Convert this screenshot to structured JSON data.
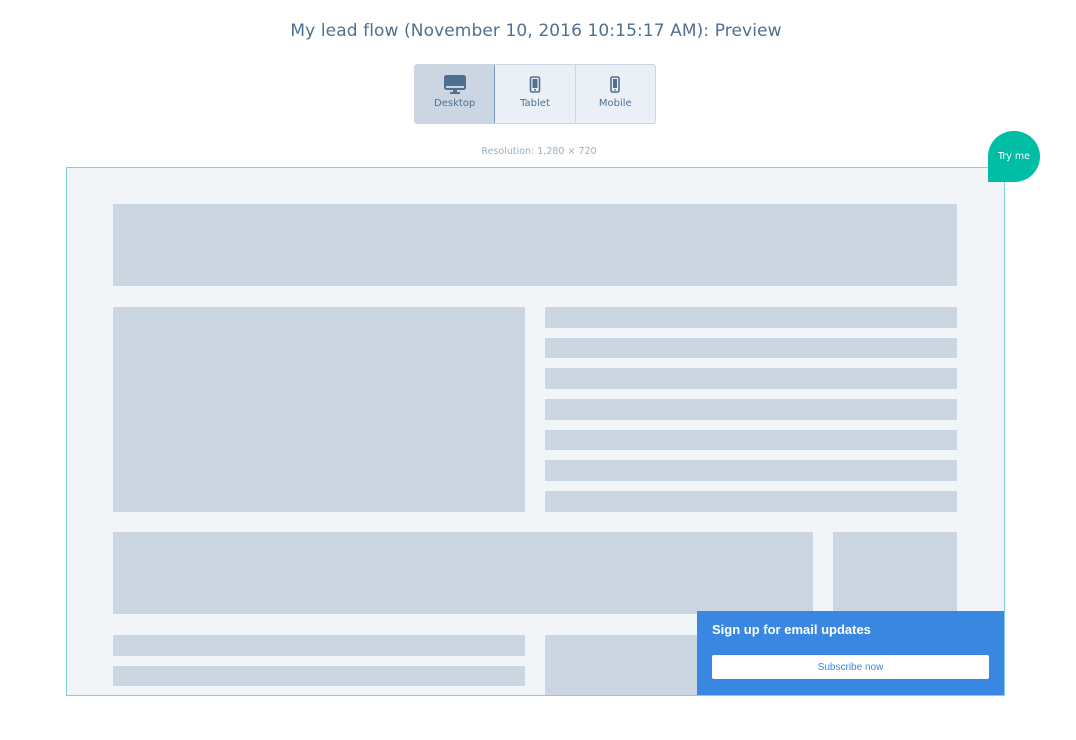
{
  "header": {
    "title": "My lead flow (November 10, 2016 10:15:17 AM): Preview"
  },
  "device_switch": {
    "active": "desktop",
    "options": [
      {
        "id": "desktop",
        "label": "Desktop",
        "icon": "desktop-icon"
      },
      {
        "id": "tablet",
        "label": "Tablet",
        "icon": "tablet-icon"
      },
      {
        "id": "mobile",
        "label": "Mobile",
        "icon": "mobile-icon"
      }
    ]
  },
  "resolution": {
    "text": "Resolution: 1,280 × 720"
  },
  "try_me": {
    "label": "Try me"
  },
  "lead_popup": {
    "headline": "Sign up for email updates",
    "button_label": "Subscribe now"
  },
  "colors": {
    "accent_blue": "#3a87e1",
    "teal": "#00bda5",
    "placeholder": "#cbd6e2",
    "frame_background": "#f2f5f8",
    "text_slate": "#516f90"
  }
}
